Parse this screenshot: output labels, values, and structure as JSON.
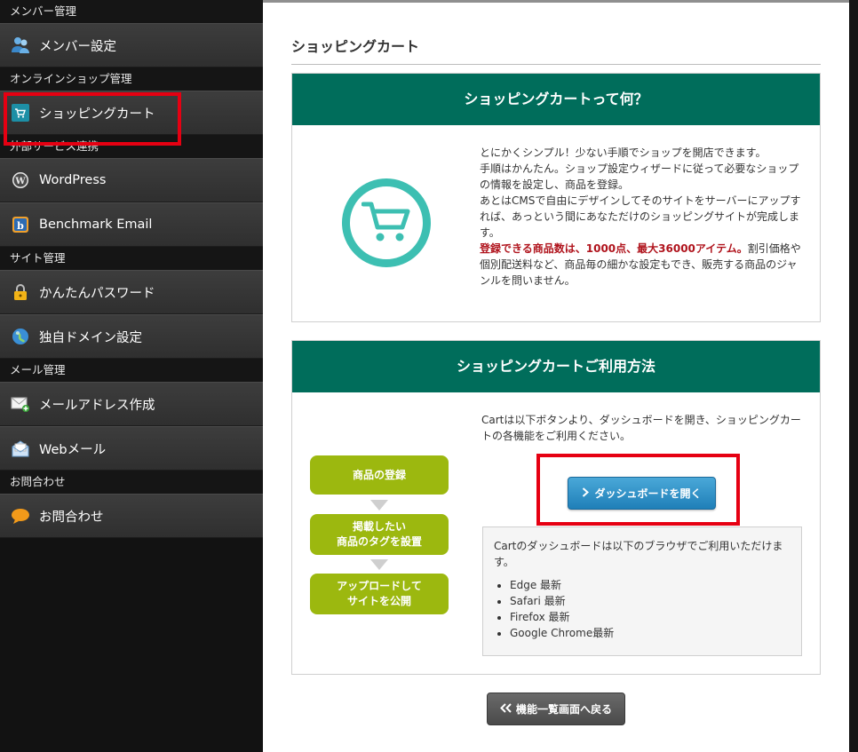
{
  "sidebar": {
    "sections": [
      {
        "heading": "メンバー管理",
        "items": [
          {
            "label": "メンバー設定",
            "icon": "members-icon"
          }
        ]
      },
      {
        "heading": "オンラインショップ管理",
        "items": [
          {
            "label": "ショッピングカート",
            "icon": "cart-icon"
          }
        ]
      },
      {
        "heading": "外部サービス連携",
        "items": [
          {
            "label": "WordPress",
            "icon": "wordpress-icon"
          },
          {
            "label": "Benchmark Email",
            "icon": "benchmark-icon"
          }
        ]
      },
      {
        "heading": "サイト管理",
        "items": [
          {
            "label": "かんたんパスワード",
            "icon": "lock-icon"
          },
          {
            "label": "独自ドメイン設定",
            "icon": "globe-icon"
          }
        ]
      },
      {
        "heading": "メール管理",
        "items": [
          {
            "label": "メールアドレス作成",
            "icon": "mail-add-icon"
          },
          {
            "label": "Webメール",
            "icon": "webmail-icon"
          }
        ]
      },
      {
        "heading": "お問合わせ",
        "items": [
          {
            "label": "お問合わせ",
            "icon": "chat-icon"
          }
        ]
      }
    ]
  },
  "main": {
    "title": "ショッピングカート",
    "about": {
      "heading": "ショッピングカートって何？",
      "para1": "とにかくシンプル！少ない手順でショップを開店できます。",
      "para2": "手順はかんたん。ショップ設定ウィザードに従って必要なショップの情報を設定し、商品を登録。",
      "para3": "あとはCMSで自由にデザインしてそのサイトをサーバーにアップすれば、あっという間にあなただけのショッピングサイトが完成します。",
      "highlight": "登録できる商品数は、1000点、最大36000アイテム。",
      "para4": "割引価格や個別配送料など、商品毎の細かな設定もでき、販売する商品のジャンルを問いません。"
    },
    "usage": {
      "heading": "ショッピングカートご利用方法",
      "steps": [
        "商品の登録",
        "掲載したい\n商品のタグを設置",
        "アップロードして\nサイトを公開"
      ],
      "intro": "Cartは以下ボタンより、ダッシュボードを開き、ショッピングカートの各機能をご利用ください。",
      "button_label": "ダッシュボードを開く",
      "browser_note": "Cartのダッシュボードは以下のブラウザでご利用いただけます。",
      "browsers": [
        "Edge 最新",
        "Safari 最新",
        "Firefox 最新",
        "Google Chrome最新"
      ]
    },
    "back_label": "機能一覧画面へ戻る"
  },
  "colors": {
    "panel_header": "#006d5b",
    "step": "#9cb80f",
    "highlight": "#e60012",
    "accent_teal": "#3dbfb2",
    "button_blue": "#1f7fb8"
  }
}
